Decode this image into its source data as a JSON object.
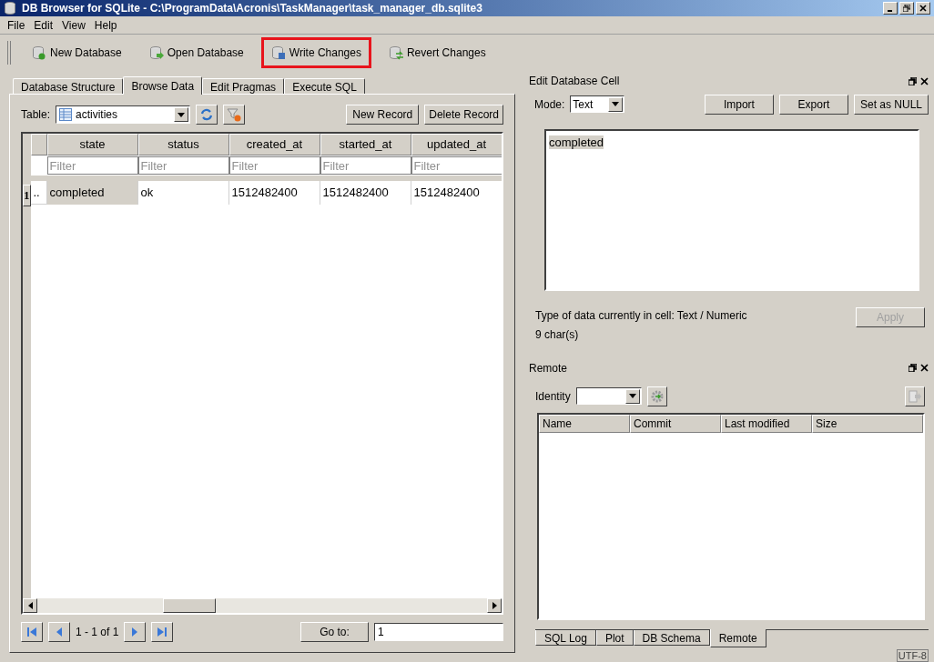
{
  "window": {
    "title": "DB Browser for SQLite - C:\\ProgramData\\Acronis\\TaskManager\\task_manager_db.sqlite3"
  },
  "menu": [
    "File",
    "Edit",
    "View",
    "Help"
  ],
  "toolbar": [
    {
      "label": "New Database",
      "kind": "new",
      "highlighted": false
    },
    {
      "label": "Open Database",
      "kind": "open",
      "highlighted": false
    },
    {
      "label": "Write Changes",
      "kind": "write",
      "highlighted": true
    },
    {
      "label": "Revert Changes",
      "kind": "revert",
      "highlighted": false
    }
  ],
  "tabs": [
    {
      "label": "Database Structure",
      "selected": false
    },
    {
      "label": "Browse Data",
      "selected": true
    },
    {
      "label": "Edit Pragmas",
      "selected": false
    },
    {
      "label": "Execute SQL",
      "selected": false
    }
  ],
  "browse": {
    "table_label": "Table:",
    "table_value": "activities",
    "new_record": "New Record",
    "delete_record": "Delete Record",
    "columns": [
      {
        "label": "state",
        "placeholder": "Filter"
      },
      {
        "label": "status",
        "placeholder": "Filter"
      },
      {
        "label": "created_at",
        "placeholder": "Filter"
      },
      {
        "label": "started_at",
        "placeholder": "Filter"
      },
      {
        "label": "updated_at",
        "placeholder": "Filter"
      }
    ],
    "rows": [
      {
        "header": "1",
        "leading_cell": "..",
        "cells": [
          {
            "text": "completed",
            "selected": true
          },
          {
            "text": "ok",
            "selected": false
          },
          {
            "text": "1512482400",
            "selected": false
          },
          {
            "text": "1512482400",
            "selected": false
          },
          {
            "text": "1512482400",
            "selected": false
          }
        ]
      }
    ],
    "pager": "1 - 1 of 1",
    "goto_button": "Go to:",
    "goto_value": "1"
  },
  "edit_cell": {
    "title": "Edit Database Cell",
    "mode_label": "Mode:",
    "mode_value": "Text",
    "buttons": [
      "Import",
      "Export",
      "Set as NULL"
    ],
    "content": "completed",
    "type_info": "Type of data currently in cell: Text / Numeric",
    "char_count": "9 char(s)",
    "apply": {
      "label": "Apply",
      "disabled": true
    }
  },
  "remote": {
    "title": "Remote",
    "identity_label": "Identity",
    "columns": [
      "Name",
      "Commit",
      "Last modified",
      "Size"
    ]
  },
  "bottom_tabs": [
    {
      "label": "SQL Log",
      "selected": false
    },
    {
      "label": "Plot",
      "selected": false
    },
    {
      "label": "DB Schema",
      "selected": false
    },
    {
      "label": "Remote",
      "selected": true
    }
  ],
  "status_bar": {
    "encoding": "UTF-8"
  }
}
